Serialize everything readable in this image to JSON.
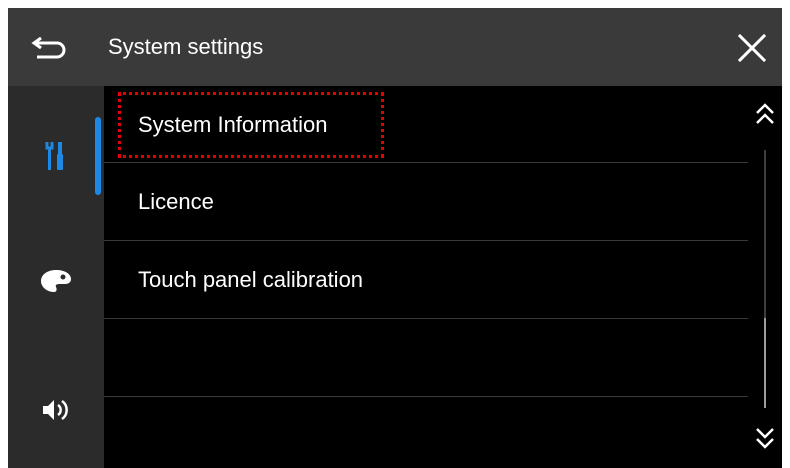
{
  "header": {
    "title": "System settings",
    "back_icon": "back-arrow-icon",
    "close_icon": "close-icon"
  },
  "sidebar": {
    "items": [
      {
        "icon": "tools-icon",
        "active": true
      },
      {
        "icon": "palette-icon",
        "active": false
      },
      {
        "icon": "speaker-icon",
        "active": false
      }
    ],
    "active_color": "#1e88e5"
  },
  "list": {
    "items": [
      {
        "label": "System Information",
        "highlighted": true
      },
      {
        "label": "Licence"
      },
      {
        "label": "Touch panel calibration"
      },
      {
        "label": ""
      },
      {
        "label": ""
      }
    ],
    "highlight_color": "#e00000"
  },
  "scroll": {
    "up_icon": "double-chevron-up-icon",
    "down_icon": "double-chevron-down-icon",
    "position": 1.0
  }
}
